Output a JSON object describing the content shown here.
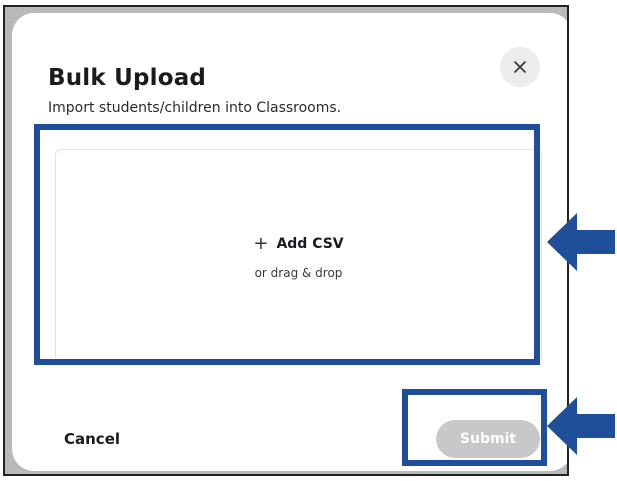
{
  "dialog": {
    "title": "Bulk Upload",
    "subtitle": "Import students/children into Classrooms.",
    "close_icon": "close-icon"
  },
  "upload": {
    "add_label": "Add CSV",
    "drag_text": "or drag & drop",
    "plus_icon": "plus-icon"
  },
  "footer": {
    "cancel_label": "Cancel",
    "submit_label": "Submit"
  },
  "annotations": {
    "highlight_color": "#1f4e9a",
    "arrow_color": "#1f4e9a"
  }
}
